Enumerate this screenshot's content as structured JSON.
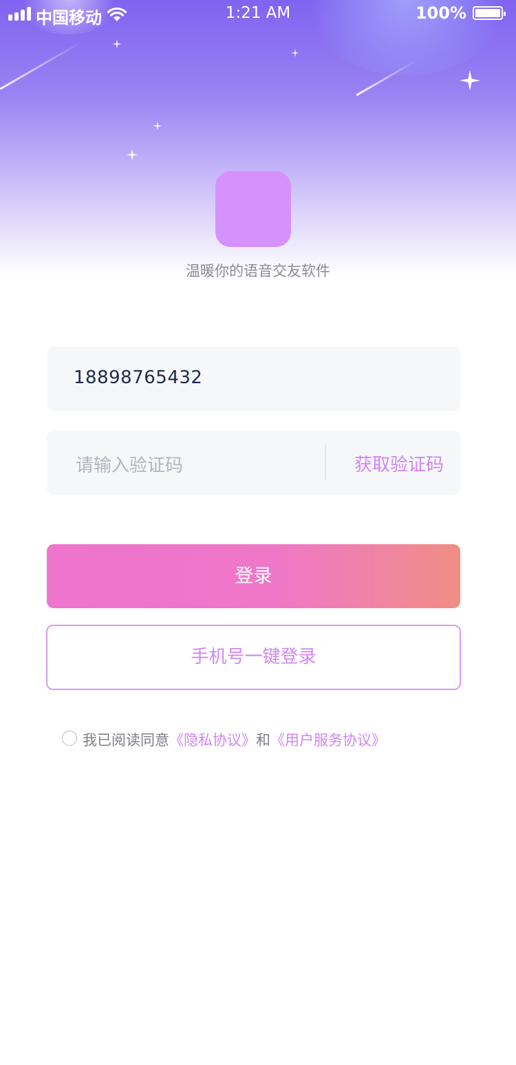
{
  "status_bar": {
    "carrier": "中国移动",
    "time": "1:21 AM",
    "battery": "100%"
  },
  "app": {
    "slogan": "温暖你的语音交友软件"
  },
  "form": {
    "phone_value": "18898765432",
    "code_placeholder": "请输入验证码",
    "get_code_label": "获取验证码"
  },
  "buttons": {
    "login": "登录",
    "one_key_login": "手机号一键登录"
  },
  "agreement": {
    "prefix": "我已阅读同意",
    "privacy": "《隐私协议》",
    "and": "和",
    "service": "《用户服务协议》"
  },
  "colors": {
    "accent": "#d185f3",
    "login_gradient_start": "#ee74cd",
    "login_gradient_end": "#f08e84",
    "logo": "#d691fd"
  },
  "icons": [
    "signal-icon",
    "wifi-icon",
    "battery-icon",
    "sparkle-icon",
    "radio-unchecked-icon"
  ]
}
